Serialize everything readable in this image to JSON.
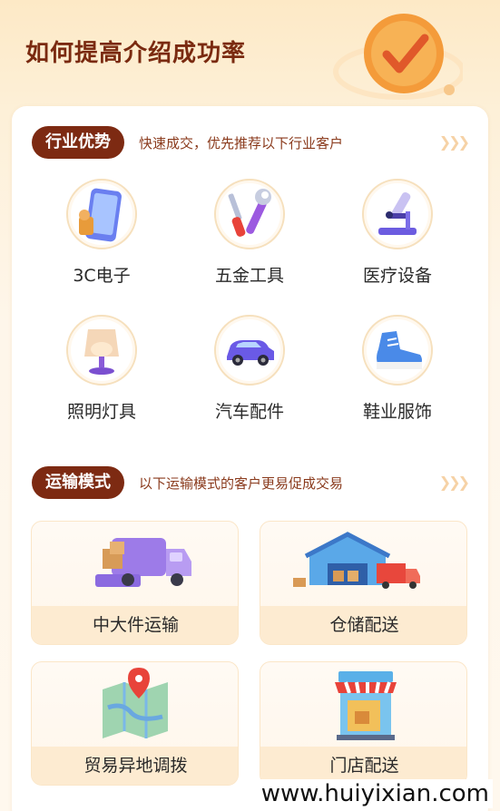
{
  "header": {
    "title": "如何提高介绍成功率"
  },
  "industry": {
    "title": "行业优势",
    "desc": "快速成交，优先推荐以下行业客户",
    "items": [
      {
        "label": "3C电子",
        "icon": "phone-icon"
      },
      {
        "label": "五金工具",
        "icon": "tools-icon"
      },
      {
        "label": "医疗设备",
        "icon": "microscope-icon"
      },
      {
        "label": "照明灯具",
        "icon": "lamp-icon"
      },
      {
        "label": "汽车配件",
        "icon": "car-icon"
      },
      {
        "label": "鞋业服饰",
        "icon": "sneaker-icon"
      }
    ]
  },
  "transport": {
    "title": "运输模式",
    "desc": "以下运输模式的客户更易促成交易",
    "items": [
      {
        "label": "中大件运输",
        "icon": "truck-icon"
      },
      {
        "label": "仓储配送",
        "icon": "warehouse-icon"
      },
      {
        "label": "贸易异地调拨",
        "icon": "map-icon"
      },
      {
        "label": "门店配送",
        "icon": "store-icon"
      }
    ]
  },
  "watermark": "www.huiyixian.com",
  "colors": {
    "accent": "#7d2a12",
    "title": "#7a2a10",
    "badge": "#f08a24"
  }
}
